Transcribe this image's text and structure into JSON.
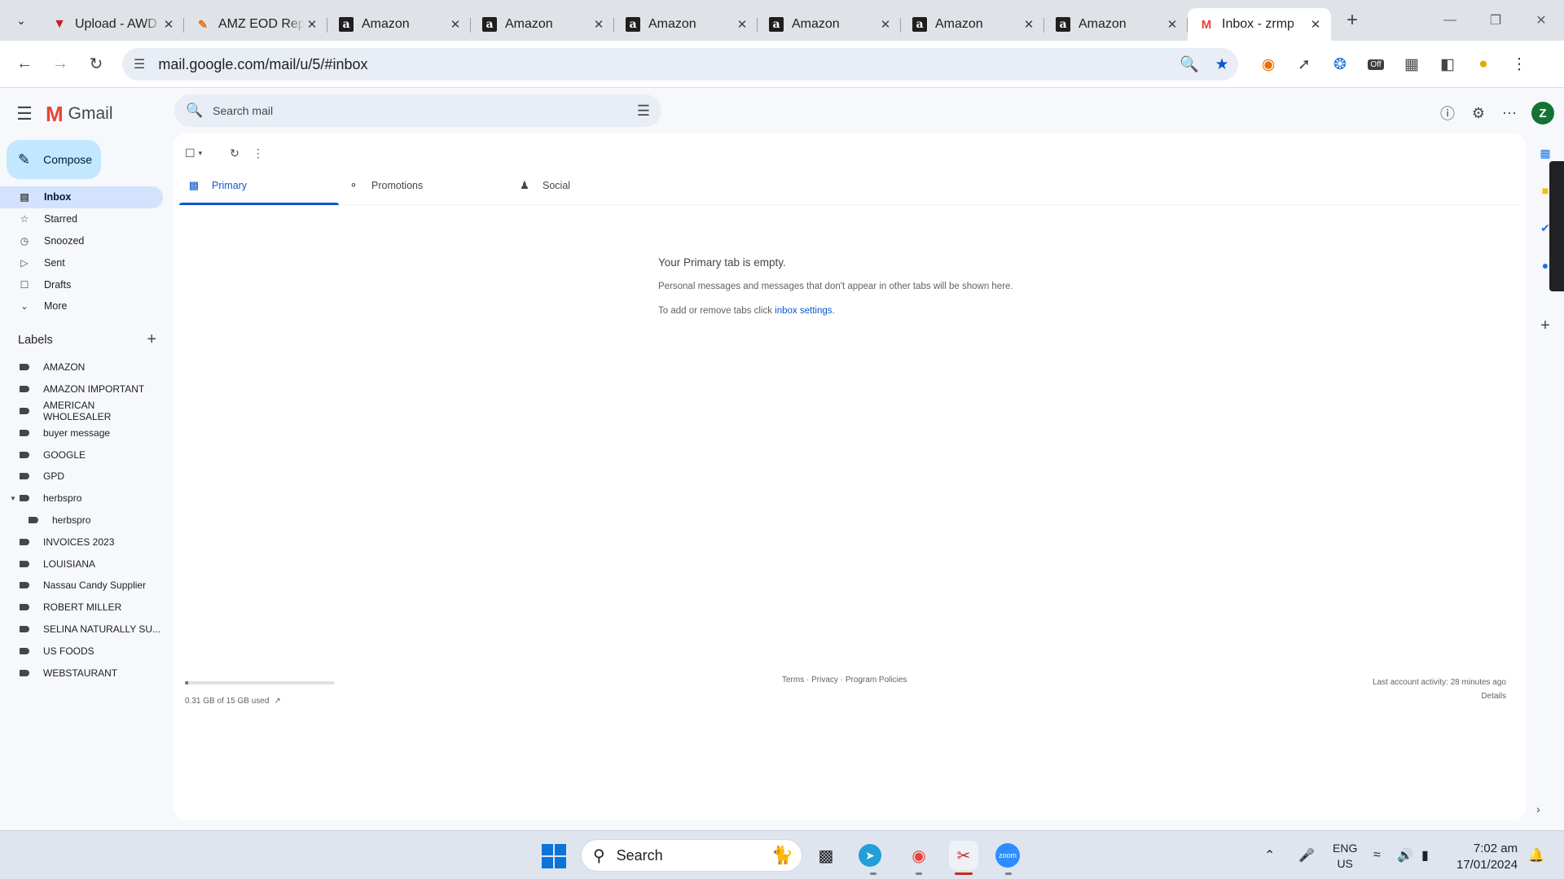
{
  "browser": {
    "tabs": [
      {
        "title": "Upload - AWD",
        "favicon": "v-icon",
        "active": false
      },
      {
        "title": "AMZ EOD Report",
        "favicon": "pen-icon",
        "active": false
      },
      {
        "title": "Amazon",
        "favicon": "amazon-icon",
        "active": false
      },
      {
        "title": "Amazon",
        "favicon": "amazon-icon",
        "active": false
      },
      {
        "title": "Amazon",
        "favicon": "amazon-icon",
        "active": false
      },
      {
        "title": "Amazon",
        "favicon": "amazon-icon",
        "active": false
      },
      {
        "title": "Amazon",
        "favicon": "amazon-icon",
        "active": false
      },
      {
        "title": "Amazon",
        "favicon": "amazon-icon",
        "active": false
      },
      {
        "title": "Inbox - zrmp",
        "favicon": "gmail-icon",
        "active": true
      }
    ],
    "url": "mail.google.com/mail/u/5/#inbox",
    "extension_badge": "Off"
  },
  "gmail": {
    "app_name": "Gmail",
    "search_placeholder": "Search mail",
    "avatar_letter": "Z",
    "compose_label": "Compose",
    "nav": [
      {
        "label": "Inbox",
        "icon": "inbox-icon",
        "active": true
      },
      {
        "label": "Starred",
        "icon": "star-icon",
        "active": false
      },
      {
        "label": "Snoozed",
        "icon": "clock-icon",
        "active": false
      },
      {
        "label": "Sent",
        "icon": "send-icon",
        "active": false
      },
      {
        "label": "Drafts",
        "icon": "draft-icon",
        "active": false
      },
      {
        "label": "More",
        "icon": "chevron-down-icon",
        "active": false
      }
    ],
    "labels_heading": "Labels",
    "labels": [
      {
        "label": "AMAZON",
        "level": 0
      },
      {
        "label": "AMAZON IMPORTANT",
        "level": 0
      },
      {
        "label": "AMERICAN WHOLESALER",
        "level": 0
      },
      {
        "label": "buyer message",
        "level": 0
      },
      {
        "label": "GOOGLE",
        "level": 0
      },
      {
        "label": "GPD",
        "level": 0
      },
      {
        "label": "herbspro",
        "level": 0,
        "expanded": true
      },
      {
        "label": "herbspro",
        "level": 1
      },
      {
        "label": "INVOICES 2023",
        "level": 0
      },
      {
        "label": "LOUISIANA",
        "level": 0
      },
      {
        "label": "Nassau Candy Supplier",
        "level": 0
      },
      {
        "label": "ROBERT MILLER",
        "level": 0
      },
      {
        "label": "SELINA NATURALLY SU...",
        "level": 0
      },
      {
        "label": "US FOODS",
        "level": 0
      },
      {
        "label": "WEBSTAURANT",
        "level": 0
      }
    ],
    "inbox_tabs": [
      {
        "label": "Primary",
        "icon": "inbox-tab-icon",
        "active": true
      },
      {
        "label": "Promotions",
        "icon": "tag-icon",
        "active": false
      },
      {
        "label": "Social",
        "icon": "people-icon",
        "active": false
      }
    ],
    "empty_state": {
      "heading": "Your Primary tab is empty.",
      "line1": "Personal messages and messages that don't appear in other tabs will be shown here.",
      "line2_prefix": "To add or remove tabs click ",
      "line2_link": "inbox settings",
      "line2_suffix": "."
    },
    "footer": {
      "storage_used": "0.31 GB of 15 GB used",
      "storage_fraction": 0.021,
      "terms": "Terms",
      "privacy": "Privacy",
      "policies": "Program Policies",
      "sep": " · ",
      "activity": "Last account activity: 28 minutes ago",
      "details": "Details"
    }
  },
  "taskbar": {
    "search_label": "Search",
    "lang_line1": "ENG",
    "lang_line2": "US",
    "time": "7:02 am",
    "date": "17/01/2024"
  },
  "colors": {
    "accent": "#0b57d0",
    "compose_bg": "#c2e7ff",
    "active_nav_bg": "#d3e3fd",
    "avatar_bg": "#137333"
  }
}
